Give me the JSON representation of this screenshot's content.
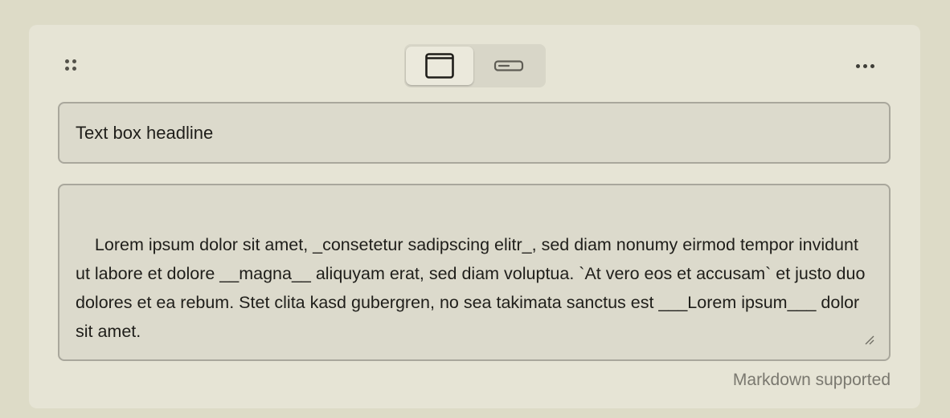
{
  "toolbar": {
    "drag_icon": "drag-handle-icon",
    "layout_options": [
      {
        "name": "card-layout",
        "icon": "window-frame-icon",
        "selected": true
      },
      {
        "name": "inline-layout",
        "icon": "input-bar-icon",
        "selected": false
      }
    ],
    "more_icon": "more-horizontal-icon"
  },
  "editor": {
    "headline_value": "Text box headline",
    "body_value": "Lorem ipsum dolor sit amet, _consetetur sadipscing elitr_, sed diam nonumy eirmod tempor invidunt ut labore et dolore __magna__ aliquyam erat, sed diam voluptua. `At vero eos et accusam` et justo duo dolores et ea rebum. Stet clita kasd gubergren, no sea takimata sanctus est ___Lorem ipsum___ dolor sit amet.",
    "hint": "Markdown supported"
  },
  "colors": {
    "background": "#dddbc7",
    "card": "#e6e4d5",
    "field": "#dcdacc",
    "field_border": "#a9a79c",
    "text": "#1f1e1a",
    "muted_text": "#7a786f"
  }
}
